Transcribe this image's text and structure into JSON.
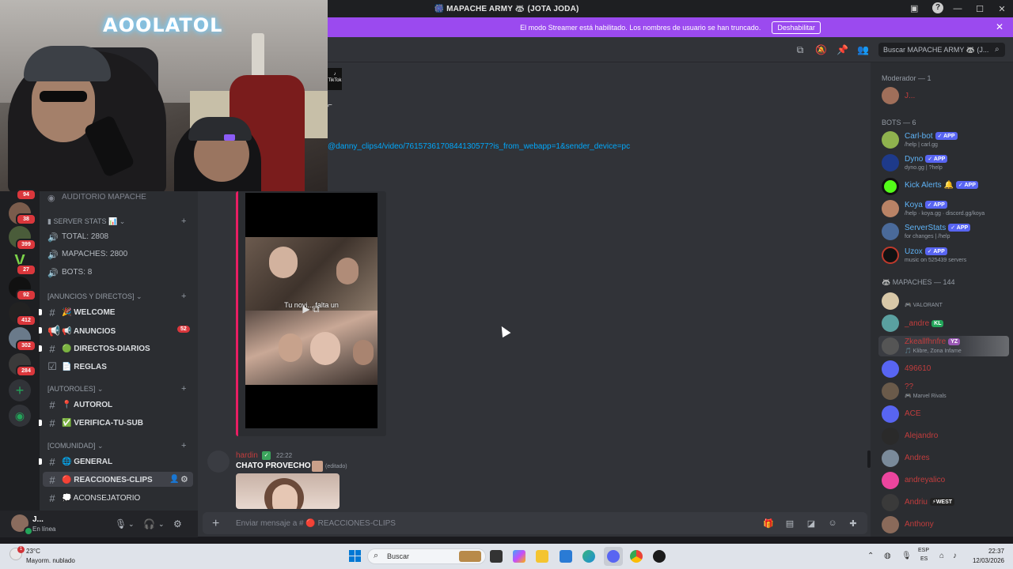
{
  "window": {
    "title": "🎆 MAPACHE ARMY 🦝 (JOTA JODA)",
    "controls": [
      "—",
      "☐",
      "✕"
    ]
  },
  "banner": {
    "text": "El modo Streamer está habilitado. Los nombres de usuario se han truncado.",
    "button": "Deshabilitar"
  },
  "header": {
    "search_placeholder": "Buscar MAPACHE ARMY 🦝 (J..."
  },
  "webcam": {
    "neon_sign": "AOOLATOL"
  },
  "servers": {
    "badges": [
      "94",
      "38",
      "399",
      "27",
      "92",
      "412",
      "302",
      "284"
    ]
  },
  "channels": {
    "top_item": "AUDITORIO MAPACHE",
    "server_stats_category": "SERVER STATS 📊",
    "stats": [
      "TOTAL: 2808",
      "MAPACHES: 2800",
      "BOTS: 8"
    ],
    "cat_announcements": "[ANUNCIOS Y DIRECTOS]",
    "cat_autoroles": "[AUTOROLES]",
    "cat_comunidad": "[COMUNIDAD]",
    "items": [
      {
        "label": "🎉 WELCOME"
      },
      {
        "label": "📢 ANUNCIOS",
        "badge": "52"
      },
      {
        "label": "🟢 DIRECTOS-DIARIOS"
      },
      {
        "label": "📄 REGLAS"
      },
      {
        "label": "📍 AUTOROL"
      },
      {
        "label": "✅ VERIFICA-TU-SUB"
      },
      {
        "label": "🌐 GENERAL"
      },
      {
        "label": "🔴 REACCIONES-CLIPS"
      },
      {
        "label": "💭 ACONSEJATORIO"
      }
    ]
  },
  "user": {
    "name": "J...",
    "status": "En línea"
  },
  "chat": {
    "link": "@danny_clips4/video/7615736170844130577?is_from_webapp=1&sender_device=pc",
    "video_subtitle": "Tu novi... falta un",
    "message": {
      "author": "hardin",
      "time": "22:22",
      "text": "CHATO PROVECHO",
      "edited": "(editado)"
    },
    "input_placeholder": "Enviar mensaje a # 🔴 REACCIONES-CLIPS"
  },
  "members": {
    "cat_moderador": "Moderador — 1",
    "moderador": "J...",
    "cat_bots": "BOTS — 6",
    "bots": [
      {
        "name": "Carl-bot",
        "sub": "/help | carl.gg",
        "tag": "✓ APP"
      },
      {
        "name": "Dyno",
        "sub": "dyno.gg | ?help",
        "tag": "✓ APP"
      },
      {
        "name": "Kick Alerts 🔔",
        "sub": "",
        "tag": "✓ APP"
      },
      {
        "name": "Koya",
        "sub": "/help · koya.gg · discord.gg/koya",
        "tag": "✓ APP"
      },
      {
        "name": "ServerStats",
        "sub": "for changes | /help",
        "tag": "✓ APP"
      },
      {
        "name": "Uzox",
        "sub": "music on 525439 servers",
        "tag": "✓ APP"
      }
    ],
    "cat_mapaches": "🦝 MAPACHES — 144",
    "mapaches": [
      {
        "name": "",
        "sub": "🎮 VALORANT"
      },
      {
        "name": "_andre",
        "sub": "",
        "tag": "KL"
      },
      {
        "name": "Zkeallfhnfre",
        "sub": "🎵 Klibre, Zona Infame",
        "tag": "YZ"
      },
      {
        "name": "496610",
        "sub": ""
      },
      {
        "name": "??",
        "sub": "🎮 Marvel Rivals"
      },
      {
        "name": "ACE",
        "sub": ""
      },
      {
        "name": "Alejandro",
        "sub": ""
      },
      {
        "name": "Andres",
        "sub": ""
      },
      {
        "name": "andreyalico",
        "sub": ""
      },
      {
        "name": "Andriu",
        "sub": "",
        "tag": "⚡WEST"
      },
      {
        "name": "Anthony",
        "sub": ""
      }
    ]
  },
  "taskbar": {
    "weather_temp": "23°C",
    "weather_desc": "Mayorm. nublado",
    "weather_badge": "1",
    "search": "Buscar",
    "lang1": "ESP",
    "lang2": "ES",
    "time": "22:37",
    "date": "12/03/2026"
  },
  "colors": {
    "banner": "#9b4aef",
    "accent_link": "#00a8fc",
    "embed_border": "#e91e63",
    "badge_red": "#da373c",
    "app_tag": "#5865f2",
    "member_red": "#c23d3d",
    "online": "#23a55a"
  }
}
